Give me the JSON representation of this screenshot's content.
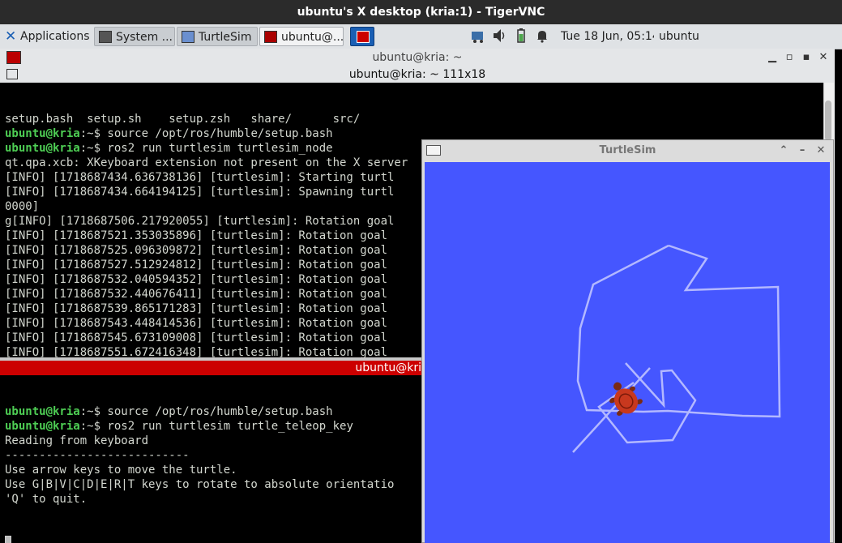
{
  "vnc": {
    "title": "ubuntu's X desktop (kria:1) - TigerVNC"
  },
  "panel": {
    "applications_label": "Applications ≡",
    "tasks": [
      {
        "label": "System ...",
        "icon": "system-monitor-icon",
        "active": false
      },
      {
        "label": "TurtleSim",
        "icon": "window-icon",
        "active": false
      },
      {
        "label": "ubuntu@...",
        "icon": "terminal-icon",
        "active": true
      }
    ],
    "clock": "Tue 18 Jun, 05:14",
    "user": "ubuntu"
  },
  "terminal": {
    "window_title": "ubuntu@kria: ~",
    "size_label": "ubuntu@kria: ~ 111x18",
    "pane1_lines": [
      {
        "text": "setup.bash  setup.sh    setup.zsh   share/      src/"
      },
      {
        "prompt": "ubuntu@kria",
        "path": ":~",
        "cmd": "$ source /opt/ros/humble/setup.bash"
      },
      {
        "prompt": "ubuntu@kria",
        "path": ":~",
        "cmd": "$ ros2 run turtlesim turtlesim_node"
      },
      {
        "text": "qt.qpa.xcb: XKeyboard extension not present on the X server"
      },
      {
        "text": "[INFO] [1718687434.636738136] [turtlesim]: Starting turtl"
      },
      {
        "text": "[INFO] [1718687434.664194125] [turtlesim]: Spawning turtl"
      },
      {
        "text": "0000]"
      },
      {
        "text": "g[INFO] [1718687506.217920055] [turtlesim]: Rotation goal"
      },
      {
        "text": "[INFO] [1718687521.353035896] [turtlesim]: Rotation goal"
      },
      {
        "text": "[INFO] [1718687525.096309872] [turtlesim]: Rotation goal"
      },
      {
        "text": "[INFO] [1718687527.512924812] [turtlesim]: Rotation goal"
      },
      {
        "text": "[INFO] [1718687532.040594352] [turtlesim]: Rotation goal"
      },
      {
        "text": "[INFO] [1718687532.440676411] [turtlesim]: Rotation goal"
      },
      {
        "text": "[INFO] [1718687539.865171283] [turtlesim]: Rotation goal"
      },
      {
        "text": "[INFO] [1718687543.448414536] [turtlesim]: Rotation goal"
      },
      {
        "text": "[INFO] [1718687545.673109008] [turtlesim]: Rotation goal"
      },
      {
        "text": "[INFO] [1718687551.672416348] [turtlesim]: Rotation goal"
      }
    ],
    "pane2_title": "ubuntu@kri",
    "pane2_lines": [
      {
        "prompt": "ubuntu@kria",
        "path": ":~",
        "cmd": "$ source /opt/ros/humble/setup.bash"
      },
      {
        "prompt": "ubuntu@kria",
        "path": ":~",
        "cmd": "$ ros2 run turtlesim turtle_teleop_key"
      },
      {
        "text": "Reading from keyboard"
      },
      {
        "text": "---------------------------"
      },
      {
        "text": "Use arrow keys to move the turtle."
      },
      {
        "text": "Use G|B|V|C|D|E|R|T keys to rotate to absolute orientatio"
      },
      {
        "text": "'Q' to quit."
      }
    ]
  },
  "turtlesim": {
    "title": "TurtleSim",
    "background_color": "#4556ff",
    "path_color": "#b3b8ff",
    "turtle_color": "#c8381e"
  }
}
